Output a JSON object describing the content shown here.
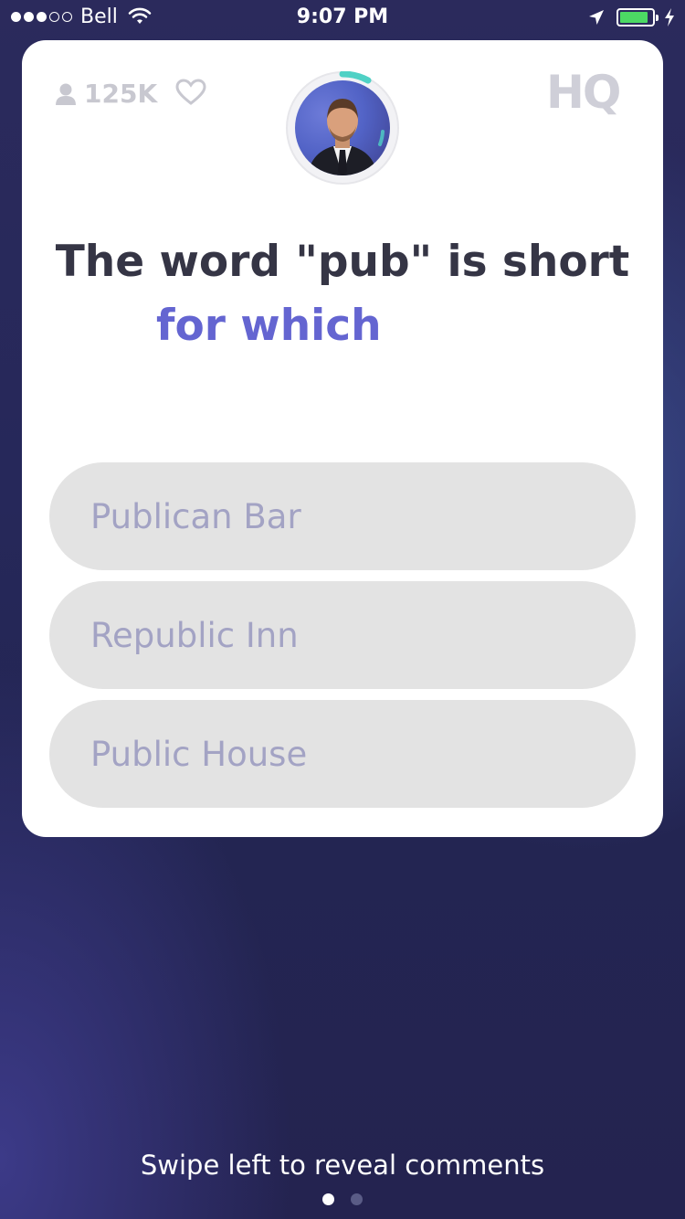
{
  "status_bar": {
    "carrier": "Bell",
    "time": "9:07 PM",
    "signal_bars": 3,
    "signal_total": 5,
    "battery_level": 0.88,
    "battery_color": "#4cd964"
  },
  "header": {
    "viewer_count": "125K",
    "logo": "HQ",
    "icons": [
      "person-icon",
      "heart-icon",
      "host-avatar"
    ]
  },
  "question": {
    "line1": "The word \"pub\" is short",
    "line2": "for which"
  },
  "answers": [
    {
      "label": "Publican Bar"
    },
    {
      "label": "Republic Inn"
    },
    {
      "label": "Public House"
    }
  ],
  "footer": {
    "hint": "Swipe left to reveal comments",
    "pages": 2,
    "active_page": 1
  },
  "colors": {
    "accent": "#6465d1",
    "timer": "#4fd1c5",
    "answer_bg": "#e3e3e3",
    "answer_text": "#a3a3c4"
  }
}
